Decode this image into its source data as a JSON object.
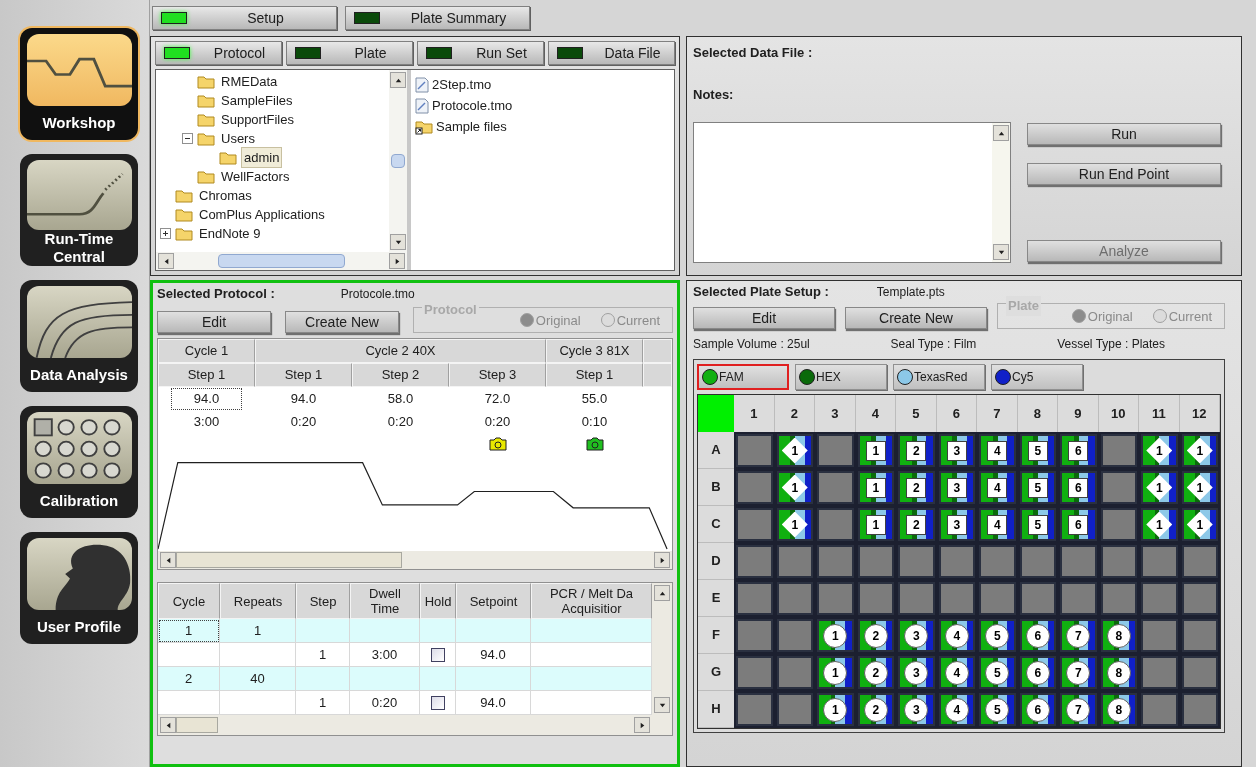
{
  "sidebar": {
    "items": [
      {
        "label": "Workshop",
        "selected": true
      },
      {
        "label": "Run-Time Central",
        "selected": false
      },
      {
        "label": "Data Analysis",
        "selected": false
      },
      {
        "label": "Calibration",
        "selected": false
      },
      {
        "label": "User Profile",
        "selected": false
      }
    ]
  },
  "tabs": [
    {
      "label": "Setup",
      "selected": true
    },
    {
      "label": "Plate Summary",
      "selected": false
    }
  ],
  "browser": {
    "tabs": [
      {
        "label": "Protocol",
        "selected": true
      },
      {
        "label": "Plate",
        "selected": false
      },
      {
        "label": "Run Set",
        "selected": false
      },
      {
        "label": "Data File",
        "selected": false
      }
    ],
    "tree": {
      "items": [
        {
          "children": [
            {
              "label": "RMEData",
              "selected": false
            },
            {
              "label": "SampleFiles",
              "selected": false
            },
            {
              "label": "SupportFiles",
              "selected": false
            },
            {
              "label": "Users",
              "selected": false,
              "expanded": true,
              "children": [
                {
                  "label": "admin",
                  "selected": true
                }
              ]
            },
            {
              "label": "WellFactors",
              "selected": false
            }
          ]
        },
        {
          "label": "Chromas",
          "selected": false
        },
        {
          "label": "ComPlus Applications",
          "selected": false
        },
        {
          "label": "EndNote 9",
          "selected": false,
          "expanded": false
        }
      ]
    },
    "files": [
      {
        "label": "2Step.tmo",
        "kind": "file"
      },
      {
        "label": "Protocole.tmo",
        "kind": "file"
      },
      {
        "label": "Sample files",
        "kind": "shortcut"
      }
    ]
  },
  "data_file": {
    "title": "Selected Data File :",
    "notes_label": "Notes:",
    "buttons": [
      {
        "label": "Run",
        "disabled": false
      },
      {
        "label": "Run End Point",
        "disabled": false
      },
      {
        "label": "Analyze",
        "disabled": true
      }
    ]
  },
  "protocol": {
    "title": "Selected Protocol :",
    "file": "Protocole.tmo",
    "buttons": [
      "Edit",
      "Create New"
    ],
    "mode": {
      "label": "Protocol",
      "options": [
        {
          "label": "Original",
          "selected": true
        },
        {
          "label": "Current",
          "selected": false
        }
      ]
    },
    "cycles": [
      {
        "label": "Cycle 1",
        "steps": [
          {
            "label": "Step 1",
            "temp": "94.0",
            "time": "3:00"
          }
        ]
      },
      {
        "label": "Cycle 2 40X",
        "steps": [
          {
            "label": "Step 1",
            "temp": "94.0",
            "time": "0:20"
          },
          {
            "label": "Step 2",
            "temp": "58.0",
            "time": "0:20"
          },
          {
            "label": "Step 3",
            "temp": "72.0",
            "time": "0:20",
            "color": "#e8e800"
          }
        ]
      },
      {
        "label": "Cycle 3 81X",
        "steps": [
          {
            "label": "Step 1",
            "temp": "55.0",
            "time": "0:10",
            "color": "#20c020"
          }
        ]
      }
    ]
  },
  "protocol_table": {
    "columns": [
      "Cycle",
      "Repeats",
      "Step",
      "Dwell\nTime",
      "Hold",
      "Setpoint",
      "PCR / Melt Da\nAcquisitior"
    ],
    "rows": [
      {
        "kind": "cycle",
        "cycle": "1",
        "repeats": "1"
      },
      {
        "kind": "step",
        "step": "1",
        "dwell": "3:00",
        "hold": false,
        "setpoint": "94.0"
      },
      {
        "kind": "cycle",
        "cycle": "2",
        "repeats": "40"
      },
      {
        "kind": "step",
        "step": "1",
        "dwell": "0:20",
        "hold": false,
        "setpoint": "94.0"
      }
    ]
  },
  "plate": {
    "title": "Selected Plate Setup :",
    "file": "Template.pts",
    "buttons": [
      "Edit",
      "Create New"
    ],
    "mode": {
      "label": "Plate",
      "options": [
        {
          "label": "Original",
          "selected": true
        },
        {
          "label": "Current",
          "selected": false
        }
      ]
    },
    "info": [
      "Sample Volume : 25ul",
      "Seal Type : Film",
      "Vessel Type : Plates"
    ],
    "dyes": [
      {
        "label": "FAM",
        "color": "#10b010",
        "selected": true
      },
      {
        "label": "HEX",
        "color": "#0a6a0a",
        "selected": false
      },
      {
        "label": "TexasRed",
        "color": "#8cc8e8",
        "selected": false
      },
      {
        "label": "Cy5",
        "color": "#1020c8",
        "selected": false
      }
    ],
    "columns": [
      "1",
      "2",
      "3",
      "4",
      "5",
      "6",
      "7",
      "8",
      "9",
      "10",
      "11",
      "12"
    ],
    "rows": [
      {
        "label": "A",
        "wells": [
          {
            "kind": "empty"
          },
          {
            "kind": "diamond",
            "label": "1"
          },
          {
            "kind": "empty"
          },
          {
            "kind": "square",
            "label": "1"
          },
          {
            "kind": "square",
            "label": "2"
          },
          {
            "kind": "square",
            "label": "3"
          },
          {
            "kind": "square",
            "label": "4"
          },
          {
            "kind": "square",
            "label": "5"
          },
          {
            "kind": "square",
            "label": "6"
          },
          {
            "kind": "empty"
          },
          {
            "kind": "diamond",
            "label": "1"
          },
          {
            "kind": "diamond",
            "label": "1"
          }
        ]
      },
      {
        "label": "B",
        "wells": [
          {
            "kind": "empty"
          },
          {
            "kind": "diamond",
            "label": "1"
          },
          {
            "kind": "empty"
          },
          {
            "kind": "square",
            "label": "1"
          },
          {
            "kind": "square",
            "label": "2"
          },
          {
            "kind": "square",
            "label": "3"
          },
          {
            "kind": "square",
            "label": "4"
          },
          {
            "kind": "square",
            "label": "5"
          },
          {
            "kind": "square",
            "label": "6"
          },
          {
            "kind": "empty"
          },
          {
            "kind": "diamond",
            "label": "1"
          },
          {
            "kind": "diamond",
            "label": "1"
          }
        ]
      },
      {
        "label": "C",
        "wells": [
          {
            "kind": "empty"
          },
          {
            "kind": "diamond",
            "label": "1"
          },
          {
            "kind": "empty"
          },
          {
            "kind": "square",
            "label": "1"
          },
          {
            "kind": "square",
            "label": "2"
          },
          {
            "kind": "square",
            "label": "3"
          },
          {
            "kind": "square",
            "label": "4"
          },
          {
            "kind": "square",
            "label": "5"
          },
          {
            "kind": "square",
            "label": "6"
          },
          {
            "kind": "empty"
          },
          {
            "kind": "diamond",
            "label": "1"
          },
          {
            "kind": "diamond",
            "label": "1"
          }
        ]
      },
      {
        "label": "D",
        "wells": [
          {
            "kind": "empty"
          },
          {
            "kind": "empty"
          },
          {
            "kind": "empty"
          },
          {
            "kind": "empty"
          },
          {
            "kind": "empty"
          },
          {
            "kind": "empty"
          },
          {
            "kind": "empty"
          },
          {
            "kind": "empty"
          },
          {
            "kind": "empty"
          },
          {
            "kind": "empty"
          },
          {
            "kind": "empty"
          },
          {
            "kind": "empty"
          }
        ]
      },
      {
        "label": "E",
        "wells": [
          {
            "kind": "empty"
          },
          {
            "kind": "empty"
          },
          {
            "kind": "empty"
          },
          {
            "kind": "empty"
          },
          {
            "kind": "empty"
          },
          {
            "kind": "empty"
          },
          {
            "kind": "empty"
          },
          {
            "kind": "empty"
          },
          {
            "kind": "empty"
          },
          {
            "kind": "empty"
          },
          {
            "kind": "empty"
          },
          {
            "kind": "empty"
          }
        ]
      },
      {
        "label": "F",
        "wells": [
          {
            "kind": "empty"
          },
          {
            "kind": "empty"
          },
          {
            "kind": "circle",
            "label": "1"
          },
          {
            "kind": "circle",
            "label": "2"
          },
          {
            "kind": "circle",
            "label": "3"
          },
          {
            "kind": "circle",
            "label": "4"
          },
          {
            "kind": "circle",
            "label": "5"
          },
          {
            "kind": "circle",
            "label": "6"
          },
          {
            "kind": "circle",
            "label": "7"
          },
          {
            "kind": "circle",
            "label": "8"
          },
          {
            "kind": "empty"
          },
          {
            "kind": "empty"
          }
        ]
      },
      {
        "label": "G",
        "wells": [
          {
            "kind": "empty"
          },
          {
            "kind": "empty"
          },
          {
            "kind": "circle",
            "label": "1"
          },
          {
            "kind": "circle",
            "label": "2"
          },
          {
            "kind": "circle",
            "label": "3"
          },
          {
            "kind": "circle",
            "label": "4"
          },
          {
            "kind": "circle",
            "label": "5"
          },
          {
            "kind": "circle",
            "label": "6"
          },
          {
            "kind": "circle",
            "label": "7"
          },
          {
            "kind": "circle",
            "label": "8"
          },
          {
            "kind": "empty"
          },
          {
            "kind": "empty"
          }
        ]
      },
      {
        "label": "H",
        "wells": [
          {
            "kind": "empty"
          },
          {
            "kind": "empty"
          },
          {
            "kind": "circle",
            "label": "1"
          },
          {
            "kind": "circle",
            "label": "2"
          },
          {
            "kind": "circle",
            "label": "3"
          },
          {
            "kind": "circle",
            "label": "4"
          },
          {
            "kind": "circle",
            "label": "5"
          },
          {
            "kind": "circle",
            "label": "6"
          },
          {
            "kind": "circle",
            "label": "7"
          },
          {
            "kind": "circle",
            "label": "8"
          },
          {
            "kind": "empty"
          },
          {
            "kind": "empty"
          }
        ]
      }
    ]
  }
}
